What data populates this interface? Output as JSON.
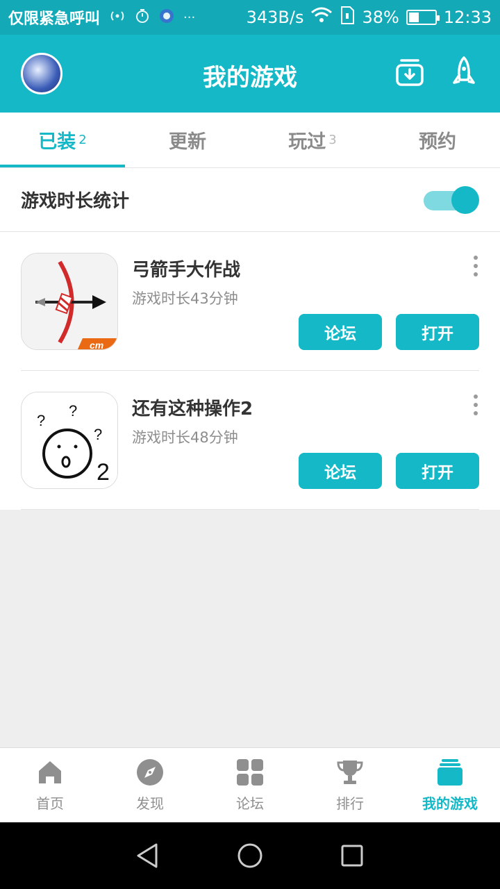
{
  "status_bar": {
    "carrier": "仅限紧急呼叫",
    "network_speed": "343B/s",
    "battery_percent": "38%",
    "battery_level": 0.38,
    "time": "12:33",
    "more": "···"
  },
  "header": {
    "title": "我的游戏",
    "icons": [
      "download-icon",
      "rocket-icon"
    ]
  },
  "tabs": [
    {
      "label": "已装",
      "count": "2",
      "active": true
    },
    {
      "label": "更新",
      "count": ""
    },
    {
      "label": "玩过",
      "count": "3"
    },
    {
      "label": "预约",
      "count": ""
    }
  ],
  "stats": {
    "label": "游戏时长统计",
    "enabled": true
  },
  "games": [
    {
      "name": "弓箭手大作战",
      "playtime": "游戏时长43分钟",
      "forum_label": "论坛",
      "open_label": "打开",
      "badge": "cm"
    },
    {
      "name": "还有这种操作2",
      "playtime": "游戏时长48分钟",
      "forum_label": "论坛",
      "open_label": "打开",
      "icon_text": "2"
    }
  ],
  "bottom_nav": [
    {
      "label": "首页",
      "icon": "home-icon"
    },
    {
      "label": "发现",
      "icon": "compass-icon"
    },
    {
      "label": "论坛",
      "icon": "grid-icon"
    },
    {
      "label": "排行",
      "icon": "trophy-icon"
    },
    {
      "label": "我的游戏",
      "icon": "my-games-icon",
      "active": true
    }
  ],
  "colors": {
    "accent": "#14b8c6",
    "status_bar": "#14a9b7",
    "background": "#eeeeee"
  }
}
